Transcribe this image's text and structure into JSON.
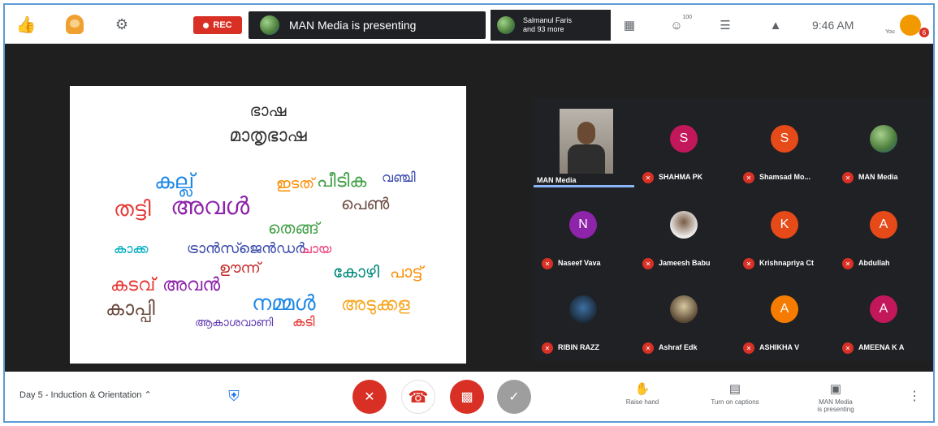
{
  "topbar": {
    "rec_label": "REC",
    "presenter_text": "MAN Media is presenting",
    "participants_line1": "Salmanul Faris",
    "participants_line2": "and 93 more",
    "participant_count": "100",
    "clock": "9:46 AM",
    "self_label": "You",
    "notif_count": "6"
  },
  "slide": {
    "title_line1": "ഭാഷ",
    "title_line2": "മാതൃഭാഷ",
    "words": [
      "കല്ല്",
      "അവൾ",
      "തട്ടി",
      "ഇടത്",
      "പീടിക",
      "വഞ്ചി",
      "കാപ്പി",
      "നമ്മൾ",
      "കടവ്",
      "അവൻ",
      "ട്രാൻസ്ജെൻഡർ",
      "കോഴി",
      "ഊന്ന്",
      "അടുക്കള",
      "തെങ്ങ്",
      "ചായ",
      "പെൺ",
      "പാട്ട്",
      "ആകാശവാണി",
      "കടി",
      "കാക്ക"
    ]
  },
  "participants": [
    {
      "name": "MAN Media",
      "initial": "",
      "color": "#6d6d6d"
    },
    {
      "name": "SHAHMA PK",
      "initial": "S",
      "color": "#c2185b"
    },
    {
      "name": "Shamsad Mo...",
      "initial": "S",
      "color": "#e64a19"
    },
    {
      "name": "MAN Media",
      "initial": "",
      "color": "#6d6d6d"
    },
    {
      "name": "Naseef Vava",
      "initial": "N",
      "color": "#8e24aa"
    },
    {
      "name": "Jameesh Babu",
      "initial": "",
      "color": "#6d6d6d"
    },
    {
      "name": "Krishnapriya Ct",
      "initial": "K",
      "color": "#e64a19"
    },
    {
      "name": "Abdullah",
      "initial": "A",
      "color": "#e64a19"
    },
    {
      "name": "RIBIN RAZZ",
      "initial": "",
      "color": "#6d6d6d"
    },
    {
      "name": "Ashraf Edk",
      "initial": "",
      "color": "#6d6d6d"
    },
    {
      "name": "ASHIKHA V",
      "initial": "A",
      "color": "#f57c00"
    },
    {
      "name": "AMEENA K A",
      "initial": "A",
      "color": "#c2185b"
    }
  ],
  "bottombar": {
    "meeting_title": "Day 5 - Induction & Orientation",
    "raise_hand": "Raise hand",
    "captions_line1": "Turn on",
    "captions_line2": "captions",
    "presenting_line1": "MAN Media",
    "presenting_line2": "is presenting"
  }
}
